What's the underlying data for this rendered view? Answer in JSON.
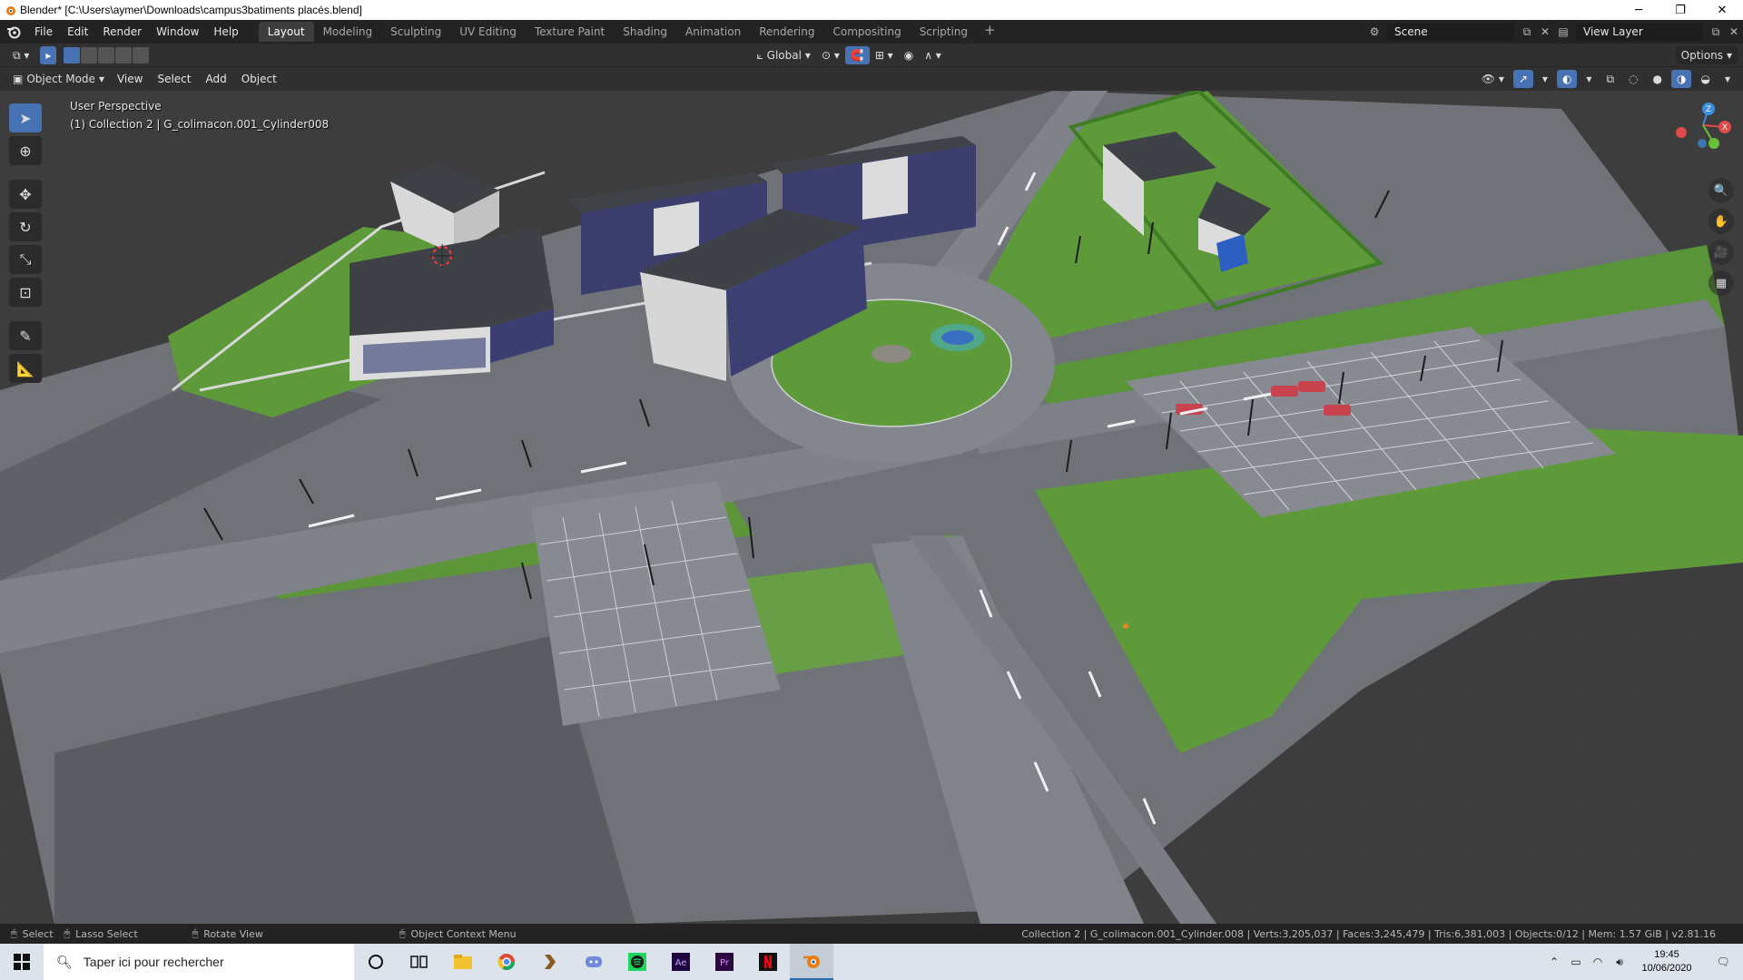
{
  "window": {
    "title": "Blender* [C:\\Users\\aymer\\Downloads\\campus3batiments placés.blend]"
  },
  "menu": [
    "File",
    "Edit",
    "Render",
    "Window",
    "Help"
  ],
  "workspaces": [
    "Layout",
    "Modeling",
    "Sculpting",
    "UV Editing",
    "Texture Paint",
    "Shading",
    "Animation",
    "Rendering",
    "Compositing",
    "Scripting"
  ],
  "active_workspace": "Layout",
  "scene": {
    "name": "Scene",
    "view_layer": "View Layer"
  },
  "header": {
    "transform_orientation": "Global",
    "options_label": "Options",
    "mode": "Object Mode",
    "menus": [
      "View",
      "Select",
      "Add",
      "Object"
    ]
  },
  "viewport": {
    "perspective_label": "User Perspective",
    "collection_label": "(1) Collection 2 | G_colimacon.001_Cylinder008"
  },
  "gizmo": {
    "axes": [
      "Z",
      "X",
      "Y"
    ],
    "colors": {
      "x": "#e04a4a",
      "y": "#6abf3a",
      "z": "#3a8fe0"
    }
  },
  "statusbar": {
    "select": "Select",
    "lasso": "Lasso Select",
    "rotate": "Rotate View",
    "context": "Object Context Menu",
    "stats": "Collection 2 | G_colimacon.001_Cylinder.008 | Verts:3,205,037 | Faces:3,245,479 | Tris:6,381,003 | Objects:0/12 | Mem: 1.57 GiB | v2.81.16"
  },
  "taskbar": {
    "search_placeholder": "Taper ici pour rechercher",
    "apps": [
      "cortana-icon",
      "task-view-icon",
      "explorer-icon",
      "chrome-icon",
      "app-icon",
      "discord-icon",
      "spotify-icon",
      "after-effects-icon",
      "premiere-icon",
      "netflix-icon",
      "blender-icon"
    ],
    "time": "19:45",
    "date": "10/06/2020"
  },
  "colors": {
    "accent": "#4772b3",
    "grass": "#5f9a3a",
    "road": "#7b7e84"
  }
}
